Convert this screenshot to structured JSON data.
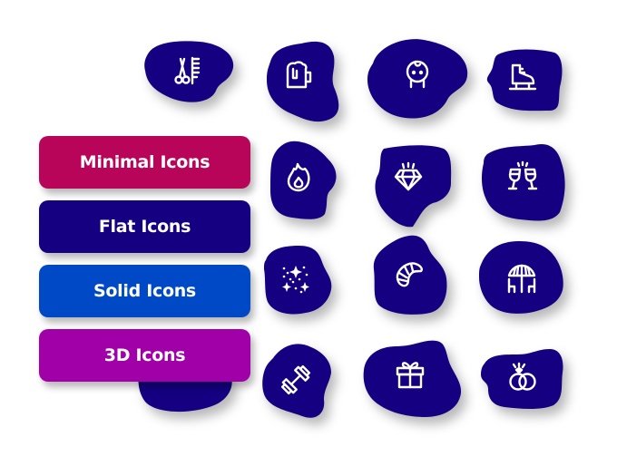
{
  "buttons": [
    {
      "label": "Minimal Icons",
      "color": "#b80459"
    },
    {
      "label": "Flat Icons",
      "color": "#140080"
    },
    {
      "label": "Solid Icons",
      "color": "#0049c6"
    },
    {
      "label": "3D Icons",
      "color": "#a100a9"
    }
  ],
  "blob_color": "#140080",
  "icon_color": "#ffffff",
  "icons": [
    {
      "name": "scissors-comb-icon",
      "label": "Barber"
    },
    {
      "name": "beer-mug-icon",
      "label": "Beer"
    },
    {
      "name": "baby-icon",
      "label": "Baby"
    },
    {
      "name": "ice-skate-icon",
      "label": "Ice Skate"
    },
    {
      "name": "fire-icon",
      "label": "Fire"
    },
    {
      "name": "diamond-icon",
      "label": "Diamond"
    },
    {
      "name": "cheers-glasses-icon",
      "label": "Cheers"
    },
    {
      "name": "sparkles-icon",
      "label": "Sparkles"
    },
    {
      "name": "croissant-icon",
      "label": "Croissant"
    },
    {
      "name": "patio-umbrella-icon",
      "label": "Patio"
    },
    {
      "name": "dumbbell-icon",
      "label": "Dumbbell"
    },
    {
      "name": "gift-icon",
      "label": "Gift"
    },
    {
      "name": "wedding-rings-icon",
      "label": "Rings"
    }
  ]
}
